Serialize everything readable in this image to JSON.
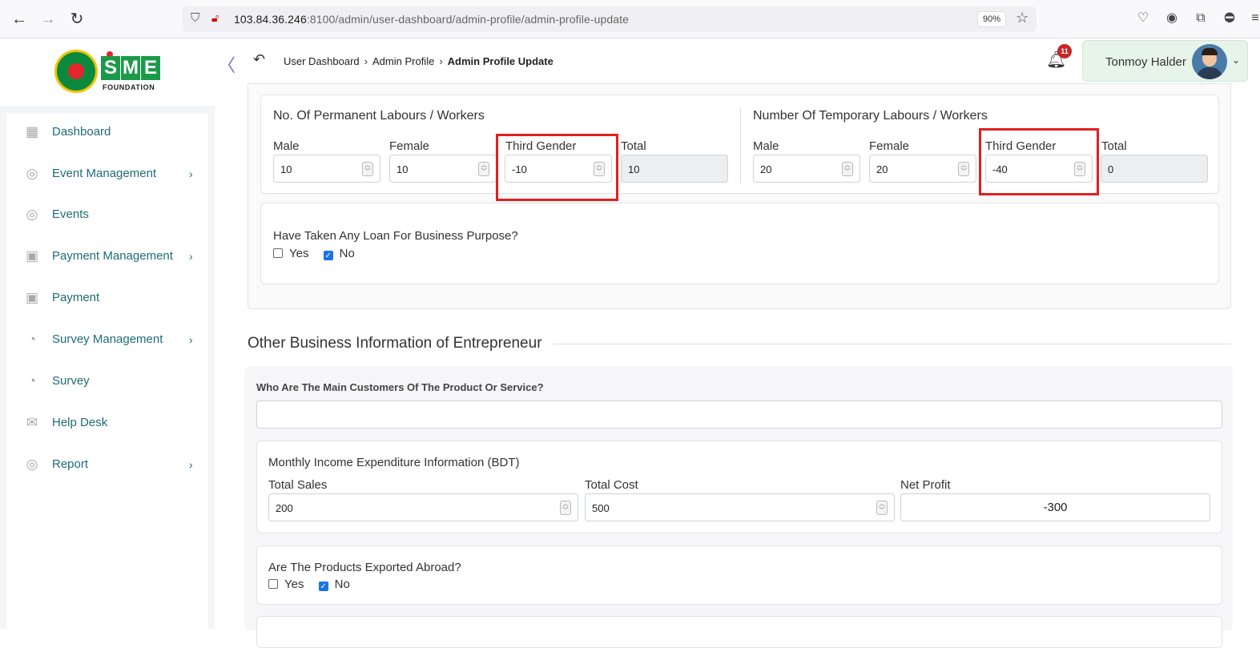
{
  "browser": {
    "url_host": "103.84.36.246",
    "url_rest": ":8100/admin/user-dashboard/admin-profile/admin-profile-update",
    "zoom": "90%"
  },
  "sidebar": {
    "logo_text": "FOUNDATION",
    "logo_letters": [
      "S",
      "M",
      "E"
    ],
    "items": [
      {
        "label": "Dashboard",
        "icon": "grid-icon",
        "has_submenu": false
      },
      {
        "label": "Event Management",
        "icon": "lock-circle-icon",
        "has_submenu": true
      },
      {
        "label": "Events",
        "icon": "lock-circle-icon",
        "has_submenu": false
      },
      {
        "label": "Payment Management",
        "icon": "cash-icon",
        "has_submenu": true
      },
      {
        "label": "Payment",
        "icon": "cash-icon",
        "has_submenu": false
      },
      {
        "label": "Survey Management",
        "icon": "pie-chart-icon",
        "has_submenu": true
      },
      {
        "label": "Survey",
        "icon": "pie-chart-icon",
        "has_submenu": false
      },
      {
        "label": "Help Desk",
        "icon": "mail-icon",
        "has_submenu": false
      },
      {
        "label": "Report",
        "icon": "lock-circle-icon",
        "has_submenu": true
      }
    ]
  },
  "header": {
    "breadcrumb": [
      "User Dashboard",
      "Admin Profile",
      "Admin Profile Update"
    ],
    "notification_count": "11",
    "user_name": "Tonmoy Halder"
  },
  "labours": {
    "permanent": {
      "title": "No. Of Permanent Labours / Workers",
      "male_label": "Male",
      "male": "10",
      "female_label": "Female",
      "female": "10",
      "third_label": "Third Gender",
      "third": "-10",
      "total_label": "Total",
      "total": "10"
    },
    "temporary": {
      "title": "Number Of Temporary Labours / Workers",
      "male_label": "Male",
      "male": "20",
      "female_label": "Female",
      "female": "20",
      "third_label": "Third Gender",
      "third": "-40",
      "total_label": "Total",
      "total": "0"
    }
  },
  "loan": {
    "question": "Have Taken Any Loan For Business Purpose?",
    "yes_label": "Yes",
    "no_label": "No",
    "yes_checked": false,
    "no_checked": true
  },
  "other": {
    "title": "Other Business Information of Entrepreneur",
    "customers_question": "Who Are The Main Customers Of The Product Or Service?",
    "customers_value": "",
    "income_title": "Monthly Income Expenditure Information (BDT)",
    "total_sales_label": "Total Sales",
    "total_sales": "200",
    "total_cost_label": "Total Cost",
    "total_cost": "500",
    "net_profit_label": "Net Profit",
    "net_profit": "-300",
    "export_question": "Are The Products Exported Abroad?",
    "export_yes_label": "Yes",
    "export_no_label": "No"
  },
  "colors": {
    "accent_teal": "#1e6b78",
    "highlight_red": "#e02020",
    "user_box_bg": "#e6f4ea",
    "checkbox_blue": "#1a73e8"
  }
}
